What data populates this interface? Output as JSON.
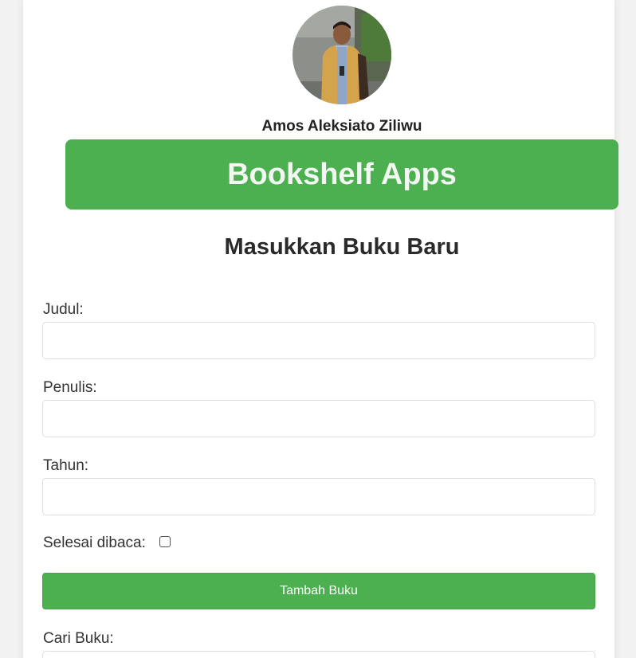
{
  "profile": {
    "name": "Amos Aleksiato Ziliwu"
  },
  "header": {
    "title": "Bookshelf Apps",
    "accent_color": "#4caf50"
  },
  "form": {
    "title": "Masukkan Buku Baru",
    "fields": [
      {
        "label": "Judul:",
        "value": ""
      },
      {
        "label": "Penulis:",
        "value": ""
      },
      {
        "label": "Tahun:",
        "value": ""
      }
    ],
    "complete_label": "Selesai dibaca:",
    "complete_checked": false,
    "submit_label": "Tambah Buku"
  },
  "search": {
    "label": "Cari Buku:"
  }
}
